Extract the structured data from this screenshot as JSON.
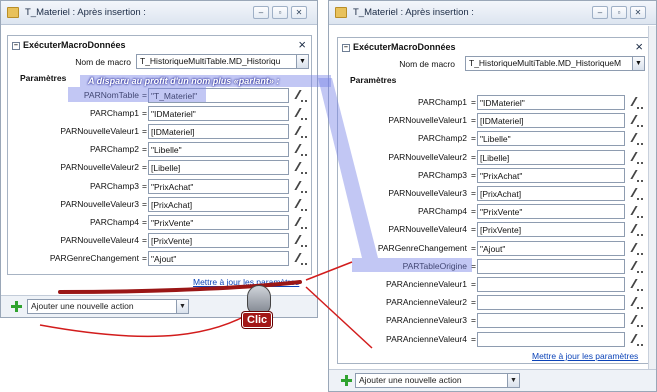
{
  "left": {
    "title": "T_Materiel : Après insertion :",
    "pane_title": "ExécuterMacroDonnées",
    "macro_label": "Nom de macro",
    "macro_value": "T_HistoriqueMultiTable.MD_Historiqu",
    "params_header": "Paramètres",
    "params": [
      {
        "label": "PARNomTable",
        "value": "\"T_Materiel\""
      },
      {
        "label": "PARChamp1",
        "value": "\"IDMateriel\""
      },
      {
        "label": "PARNouvelleValeur1",
        "value": "[IDMateriel]"
      },
      {
        "label": "PARChamp2",
        "value": "\"Libelle\""
      },
      {
        "label": "PARNouvelleValeur2",
        "value": "[Libelle]"
      },
      {
        "label": "PARChamp3",
        "value": "\"PrixAchat\""
      },
      {
        "label": "PARNouvelleValeur3",
        "value": "[PrixAchat]"
      },
      {
        "label": "PARChamp4",
        "value": "\"PrixVente\""
      },
      {
        "label": "PARNouvelleValeur4",
        "value": "[PrixVente]"
      },
      {
        "label": "PARGenreChangement",
        "value": "\"Ajout\""
      }
    ],
    "update_link": "Mettre à jour les paramètres",
    "add_action": "Ajouter une nouvelle action"
  },
  "right": {
    "title": "T_Materiel : Après insertion :",
    "pane_title": "ExécuterMacroDonnées",
    "macro_label": "Nom de macro",
    "macro_value": "T_HistoriqueMultiTable.MD_HistoriqueM",
    "params_header": "Paramètres",
    "params": [
      {
        "label": "PARChamp1",
        "value": "\"IDMateriel\""
      },
      {
        "label": "PARNouvelleValeur1",
        "value": "[IDMateriel]"
      },
      {
        "label": "PARChamp2",
        "value": "\"Libelle\""
      },
      {
        "label": "PARNouvelleValeur2",
        "value": "[Libelle]"
      },
      {
        "label": "PARChamp3",
        "value": "\"PrixAchat\""
      },
      {
        "label": "PARNouvelleValeur3",
        "value": "[PrixAchat]"
      },
      {
        "label": "PARChamp4",
        "value": "\"PrixVente\""
      },
      {
        "label": "PARNouvelleValeur4",
        "value": "[PrixVente]"
      },
      {
        "label": "PARGenreChangement",
        "value": "\"Ajout\""
      },
      {
        "label": "PARTableOrigine",
        "value": ""
      },
      {
        "label": "PARAncienneValeur1",
        "value": ""
      },
      {
        "label": "PARAncienneValeur2",
        "value": ""
      },
      {
        "label": "PARAncienneValeur3",
        "value": ""
      },
      {
        "label": "PARAncienneValeur4",
        "value": ""
      }
    ],
    "update_link": "Mettre à jour les paramètres",
    "add_action": "Ajouter une nouvelle action"
  },
  "annotation": "A disparu au profit d'un nom plus «parlant» :",
  "click_label": "Clic",
  "window_buttons": {
    "minimize": "–",
    "restore": "▫",
    "close": "✕"
  },
  "colors": {
    "highlight": "#7882e6",
    "arrow": "#d21c1c",
    "link": "#0b43b8"
  }
}
